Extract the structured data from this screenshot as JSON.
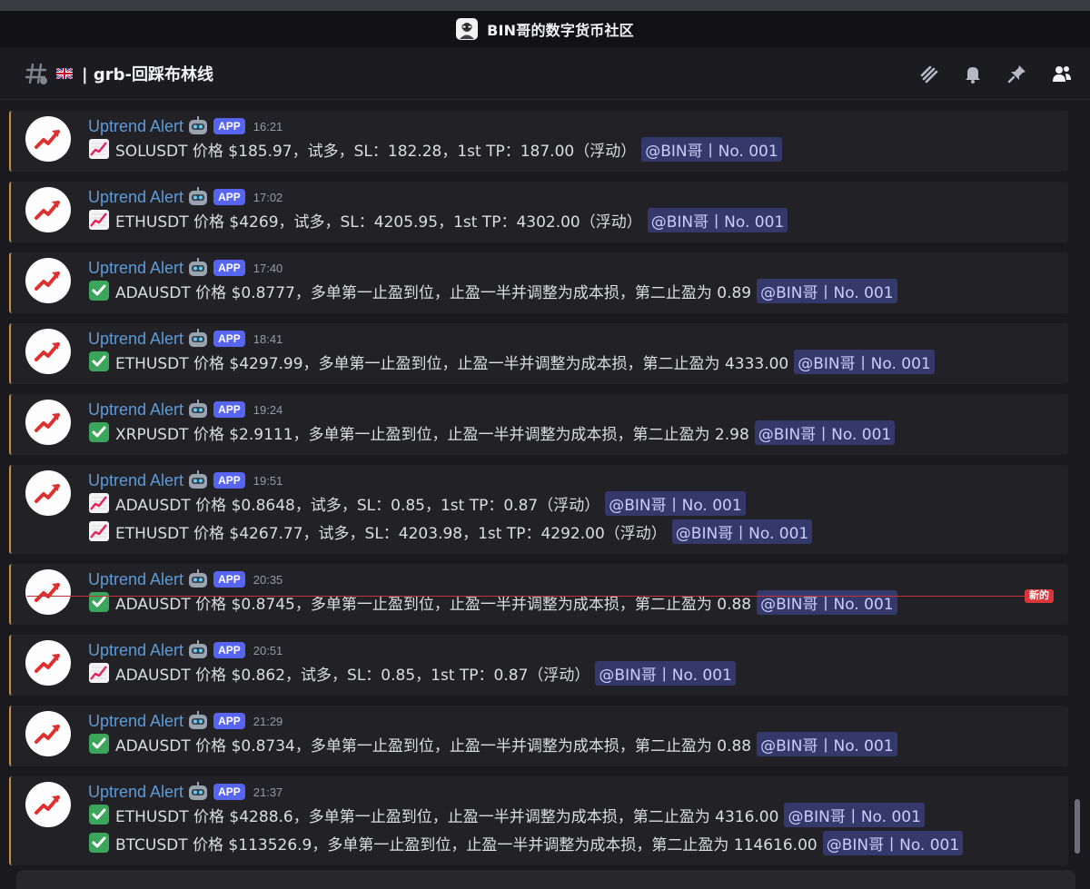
{
  "window": {
    "server_title": "BIN哥的数字货币社区"
  },
  "channel": {
    "flag_icon": "uk-flag-icon",
    "name": "| grb-回踩布林线"
  },
  "header_icons": [
    "threads-icon",
    "bell-icon",
    "pin-icon",
    "members-icon"
  ],
  "colors": {
    "author": "#5d9bd8",
    "app_badge": "#5865f2",
    "mention_bg": "#35386a",
    "new_line": "#da373c",
    "accent_bar": "#c39046"
  },
  "messages": [
    {
      "author": "Uptrend Alert",
      "badge": "APP",
      "time": "16:21",
      "lines": [
        {
          "emoji": "chart-up-icon",
          "text": "SOLUSDT 价格 $185.97，试多，SL：182.28，1st TP：187.00（浮动）",
          "mention": "@BIN哥丨No. 001"
        }
      ]
    },
    {
      "author": "Uptrend Alert",
      "badge": "APP",
      "time": "17:02",
      "lines": [
        {
          "emoji": "chart-up-icon",
          "text": "ETHUSDT 价格 $4269，试多，SL：4205.95，1st TP：4302.00（浮动）",
          "mention": "@BIN哥丨No. 001"
        }
      ]
    },
    {
      "author": "Uptrend Alert",
      "badge": "APP",
      "time": "17:40",
      "lines": [
        {
          "emoji": "check-icon",
          "text": "ADAUSDT 价格 $0.8777，多单第一止盈到位，止盈一半并调整为成本损，第二止盈为 0.89",
          "mention": "@BIN哥丨No. 001"
        }
      ]
    },
    {
      "author": "Uptrend Alert",
      "badge": "APP",
      "time": "18:41",
      "lines": [
        {
          "emoji": "check-icon",
          "text": "ETHUSDT 价格 $4297.99，多单第一止盈到位，止盈一半并调整为成本损，第二止盈为 4333.00",
          "mention": "@BIN哥丨No. 001"
        }
      ]
    },
    {
      "author": "Uptrend Alert",
      "badge": "APP",
      "time": "19:24",
      "lines": [
        {
          "emoji": "check-icon",
          "text": "XRPUSDT 价格 $2.9111，多单第一止盈到位，止盈一半并调整为成本损，第二止盈为 2.98",
          "mention": "@BIN哥丨No. 001"
        }
      ]
    },
    {
      "author": "Uptrend Alert",
      "badge": "APP",
      "time": "19:51",
      "lines": [
        {
          "emoji": "chart-up-icon",
          "text": "ADAUSDT 价格 $0.8648，试多，SL：0.85，1st TP：0.87（浮动）",
          "mention": "@BIN哥丨No. 001"
        },
        {
          "emoji": "chart-up-icon",
          "text": "ETHUSDT 价格 $4267.77，试多，SL：4203.98，1st TP：4292.00（浮动）",
          "mention": "@BIN哥丨No. 001"
        }
      ]
    },
    {
      "author": "Uptrend Alert",
      "badge": "APP",
      "time": "20:35",
      "lines": [
        {
          "emoji": "check-icon",
          "text": "ADAUSDT 价格 $0.8745，多单第一止盈到位，止盈一半并调整为成本损，第二止盈为 0.88",
          "mention": "@BIN哥丨No. 001"
        }
      ]
    },
    {
      "author": "Uptrend Alert",
      "badge": "APP",
      "time": "20:51",
      "lines": [
        {
          "emoji": "chart-up-icon",
          "text": "ADAUSDT 价格 $0.862，试多，SL：0.85，1st TP：0.87（浮动）",
          "mention": "@BIN哥丨No. 001"
        }
      ]
    },
    {
      "author": "Uptrend Alert",
      "badge": "APP",
      "time": "21:29",
      "lines": [
        {
          "emoji": "check-icon",
          "text": "ADAUSDT 价格 $0.8734，多单第一止盈到位，止盈一半并调整为成本损，第二止盈为 0.88",
          "mention": "@BIN哥丨No. 001"
        }
      ]
    },
    {
      "author": "Uptrend Alert",
      "badge": "APP",
      "time": "21:37",
      "lines": [
        {
          "emoji": "check-icon",
          "text": "ETHUSDT 价格 $4288.6，多单第一止盈到位，止盈一半并调整为成本损，第二止盈为 4316.00",
          "mention": "@BIN哥丨No. 001"
        },
        {
          "emoji": "check-icon",
          "text": "BTCUSDT 价格 $113526.9，多单第一止盈到位，止盈一半并调整为成本损，第二止盈为 114616.00",
          "mention": "@BIN哥丨No. 001"
        }
      ]
    }
  ],
  "new_divider": {
    "label": "新的"
  }
}
